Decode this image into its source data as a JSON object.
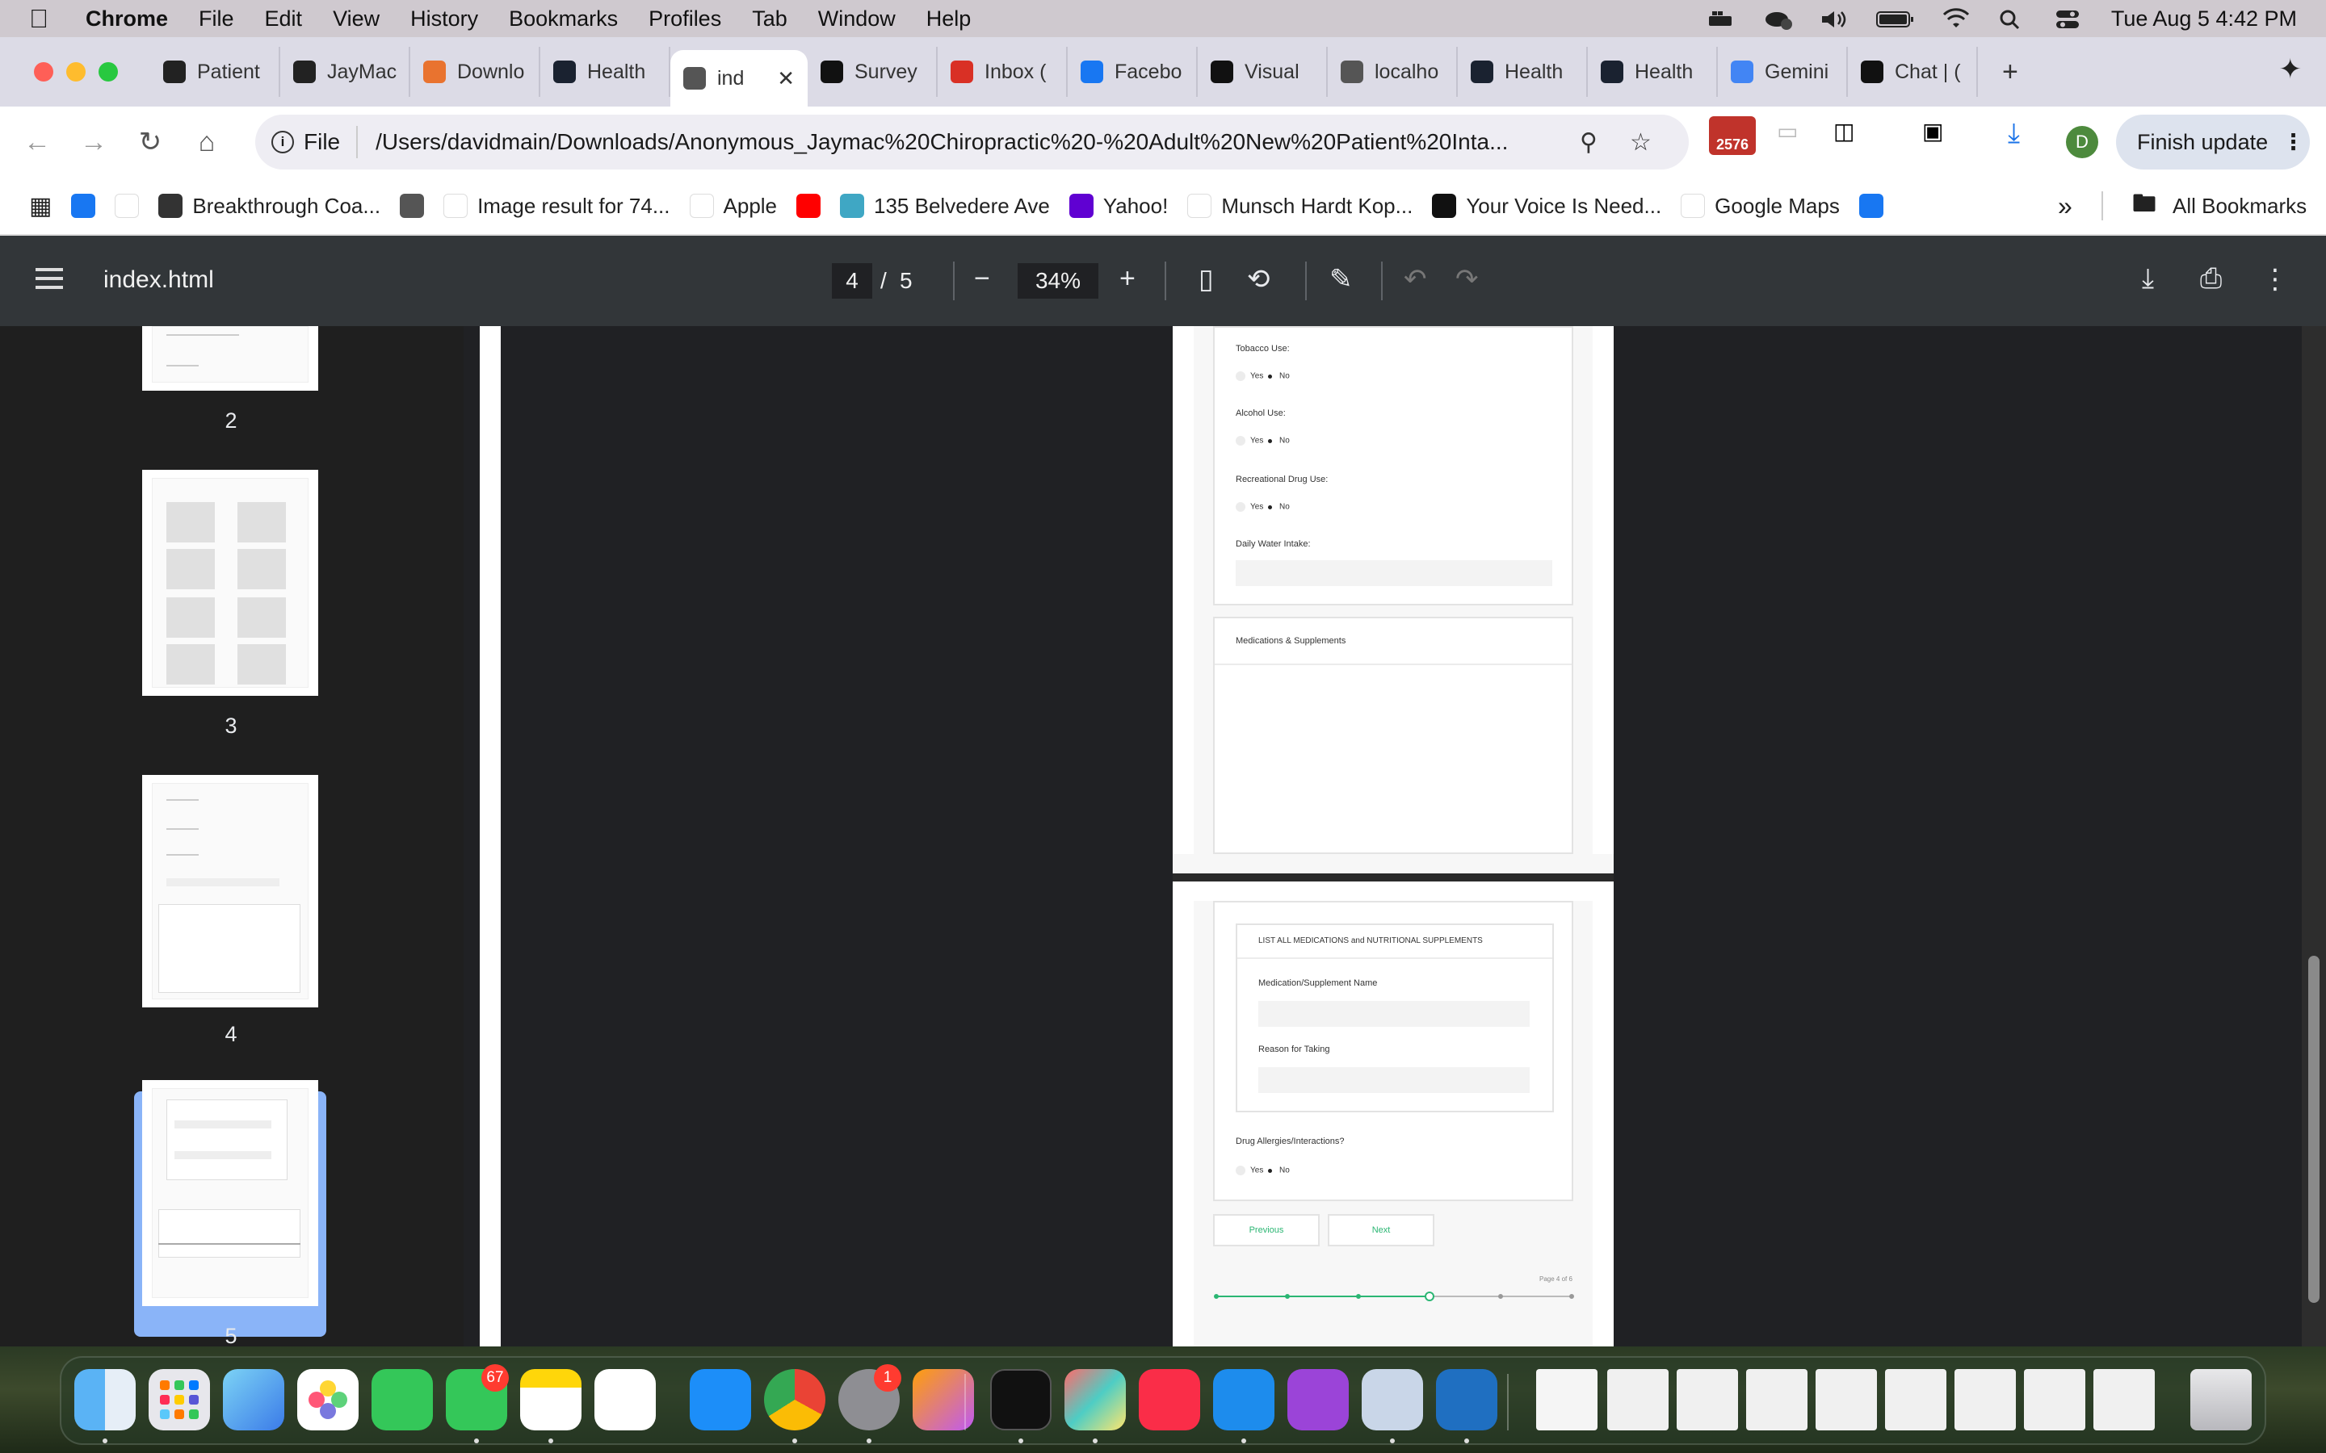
{
  "menubar": {
    "app": "Chrome",
    "items": [
      "File",
      "Edit",
      "View",
      "History",
      "Bookmarks",
      "Profiles",
      "Tab",
      "Window",
      "Help"
    ],
    "clock": "Tue Aug 5  4:42 PM"
  },
  "tabs": [
    {
      "label": "Patient",
      "icon": "target-favicon-icon",
      "color": "#222"
    },
    {
      "label": "JayMac",
      "icon": "target-favicon-icon",
      "color": "#222"
    },
    {
      "label": "Downlo",
      "icon": "multicolor-favicon-icon",
      "color": "#e9732f"
    },
    {
      "label": "Health",
      "icon": "react-favicon-icon",
      "color": "#1a2230"
    },
    {
      "label": "ind",
      "icon": "globe-icon",
      "color": "#555",
      "active": true
    },
    {
      "label": "Survey",
      "icon": "box-favicon-icon",
      "color": "#111"
    },
    {
      "label": "Inbox (",
      "icon": "gmail-icon",
      "color": "#d93025"
    },
    {
      "label": "Facebo",
      "icon": "facebook-icon",
      "color": "#1877f2"
    },
    {
      "label": "Visual",
      "icon": "x-icon",
      "color": "#111"
    },
    {
      "label": "localho",
      "icon": "globe-icon",
      "color": "#555"
    },
    {
      "label": "Health",
      "icon": "react-favicon-icon",
      "color": "#1a2230"
    },
    {
      "label": "Health",
      "icon": "react-favicon-icon",
      "color": "#1a2230"
    },
    {
      "label": "Gemini",
      "icon": "gemini-icon",
      "color": "#4285f4"
    },
    {
      "label": "Chat | (",
      "icon": "box-favicon-icon",
      "color": "#111"
    }
  ],
  "toolbar": {
    "file_chip": "File",
    "url": "/Users/davidmain/Downloads/Anonymous_Jaymac%20Chiropractic%20-%20Adult%20New%20Patient%20Inta...",
    "badge_count": "2576",
    "avatar_letter": "D",
    "finish_update": "Finish update"
  },
  "bookmarks": [
    {
      "label": "",
      "icon": "facebook-icon",
      "color": "#1877f2"
    },
    {
      "label": "",
      "icon": "amazon-icon",
      "color": "#ffffff"
    },
    {
      "label": "Breakthrough Coa...",
      "icon": "b-favicon-icon",
      "color": "#333"
    },
    {
      "label": "",
      "icon": "globe-icon",
      "color": "#555"
    },
    {
      "label": "Image result for 74...",
      "icon": "google-icon",
      "color": "#ffffff"
    },
    {
      "label": "Apple",
      "icon": "apple-icon",
      "color": "#ffffff"
    },
    {
      "label": "",
      "icon": "youtube-icon",
      "color": "#ff0000"
    },
    {
      "label": "135 Belvedere Ave",
      "icon": "house-icon",
      "color": "#3fa7c4"
    },
    {
      "label": "Yahoo!",
      "icon": "yahoo-icon",
      "color": "#6001d2"
    },
    {
      "label": "Munsch Hardt Kop...",
      "icon": "m-favicon-icon",
      "color": "#ffffff"
    },
    {
      "label": "Your Voice Is Need...",
      "icon": "m-black-favicon-icon",
      "color": "#111"
    },
    {
      "label": "Google Maps",
      "icon": "maps-pin-icon",
      "color": "#ffffff"
    },
    {
      "label": "",
      "icon": "facebook-icon",
      "color": "#1877f2"
    }
  ],
  "bookmarks_overflow": "»",
  "all_bookmarks": "All Bookmarks",
  "pdf": {
    "title": "index.html",
    "page_current": "4",
    "page_sep": "/",
    "page_total": "5",
    "zoom": "34%",
    "thumb_numbers": [
      "2",
      "3",
      "4",
      "5"
    ]
  },
  "form_page4": {
    "tobacco": "Tobacco Use:",
    "alcohol": "Alcohol Use:",
    "drugs": "Recreational Drug Use:",
    "water": "Daily Water Intake:",
    "yes": "Yes",
    "no": "No",
    "meds_header": "Medications & Supplements"
  },
  "form_page5": {
    "list_header": "LIST ALL MEDICATIONS and NUTRITIONAL SUPPLEMENTS",
    "med_name": "Medication/Supplement Name",
    "reason": "Reason for Taking",
    "allergies": "Drug Allergies/Interactions?",
    "yes": "Yes",
    "no": "No",
    "prev": "Previous",
    "next": "Next",
    "page_label": "Page 4 of 6",
    "progress_current_step": 4,
    "progress_steps": 6
  },
  "dock": {
    "messages_badge": "67",
    "settings_badge": "1"
  }
}
